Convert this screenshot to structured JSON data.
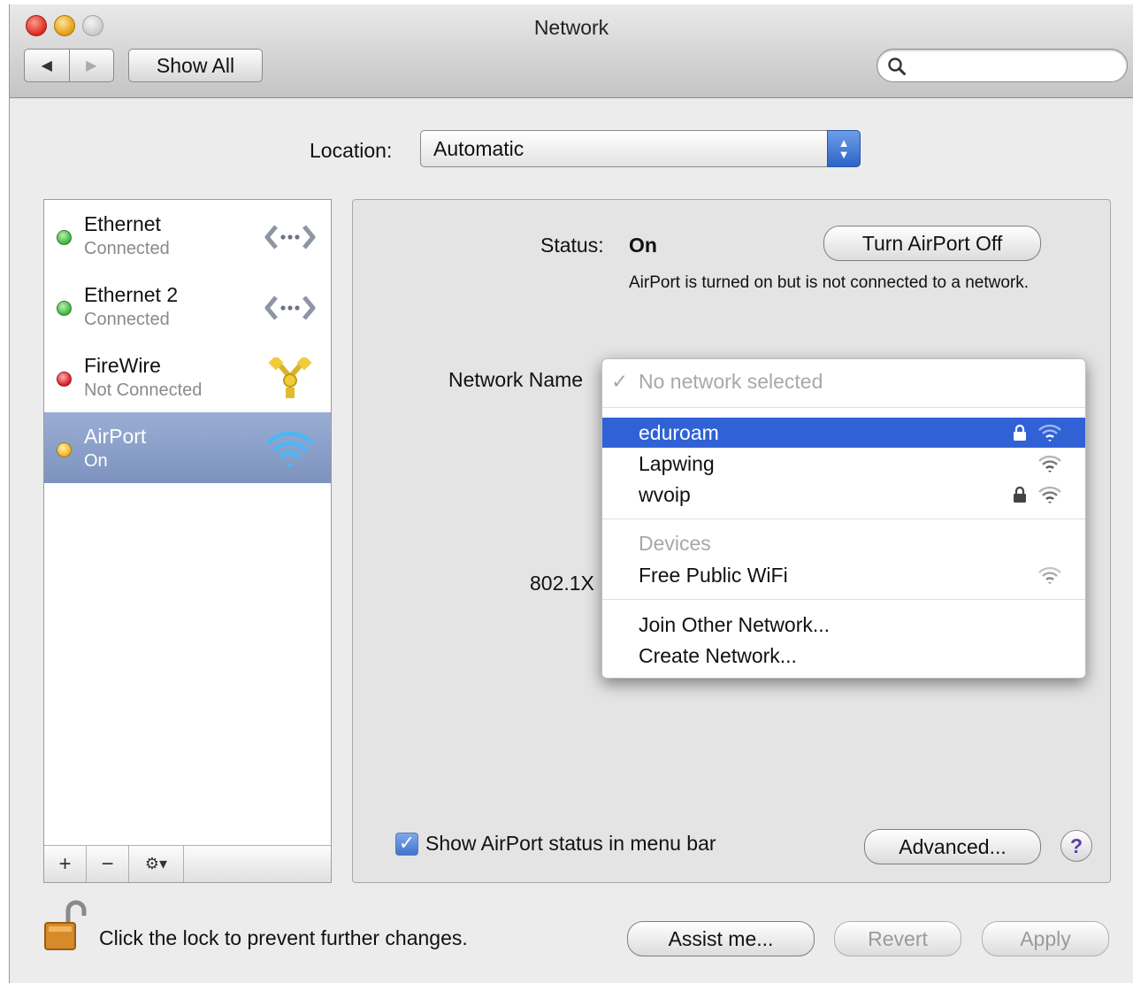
{
  "window": {
    "title": "Network"
  },
  "toolbar": {
    "back_glyph": "◀",
    "forward_glyph": "▶",
    "show_all": "Show All",
    "search_placeholder": ""
  },
  "location": {
    "label": "Location:",
    "value": "Automatic"
  },
  "services": [
    {
      "name": "Ethernet",
      "status": "Connected",
      "dot_color": "#3fb43a",
      "icon": "ethernet-icon"
    },
    {
      "name": "Ethernet 2",
      "status": "Connected",
      "dot_color": "#3fb43a",
      "icon": "ethernet-icon"
    },
    {
      "name": "FireWire",
      "status": "Not Connected",
      "dot_color": "#d71a21",
      "icon": "firewire-icon"
    },
    {
      "name": "AirPort",
      "status": "On",
      "dot_color": "#f2b21a",
      "icon": "wifi-icon",
      "selected": true
    }
  ],
  "list_footer": {
    "add": "+",
    "remove": "−",
    "gear": "⚙▾"
  },
  "detail": {
    "status_label": "Status:",
    "status_value": "On",
    "toggle_button": "Turn AirPort Off",
    "status_description": "AirPort is turned on but is not connected to a network.",
    "network_name_label": "Network Name",
    "x8021_label": "802.1X",
    "show_status_checkbox": {
      "checked": true,
      "label": "Show AirPort status in menu bar"
    },
    "advanced_button": "Advanced...",
    "help_button": "?"
  },
  "network_menu": {
    "current": {
      "check": "✓",
      "label": "No network selected"
    },
    "networks": [
      {
        "label": "eduroam",
        "locked": true,
        "highlighted": true
      },
      {
        "label": "Lapwing",
        "locked": false
      },
      {
        "label": "wvoip",
        "locked": true
      }
    ],
    "devices_header": "Devices",
    "devices": [
      {
        "label": "Free Public WiFi"
      }
    ],
    "actions": [
      "Join Other Network...",
      "Create Network..."
    ]
  },
  "footer": {
    "lock_text": "Click the lock to prevent further changes.",
    "assist": "Assist me...",
    "revert": "Revert",
    "apply": "Apply"
  },
  "colors": {
    "selection": "#3062d6",
    "list_selection": "#8aa0c9"
  }
}
